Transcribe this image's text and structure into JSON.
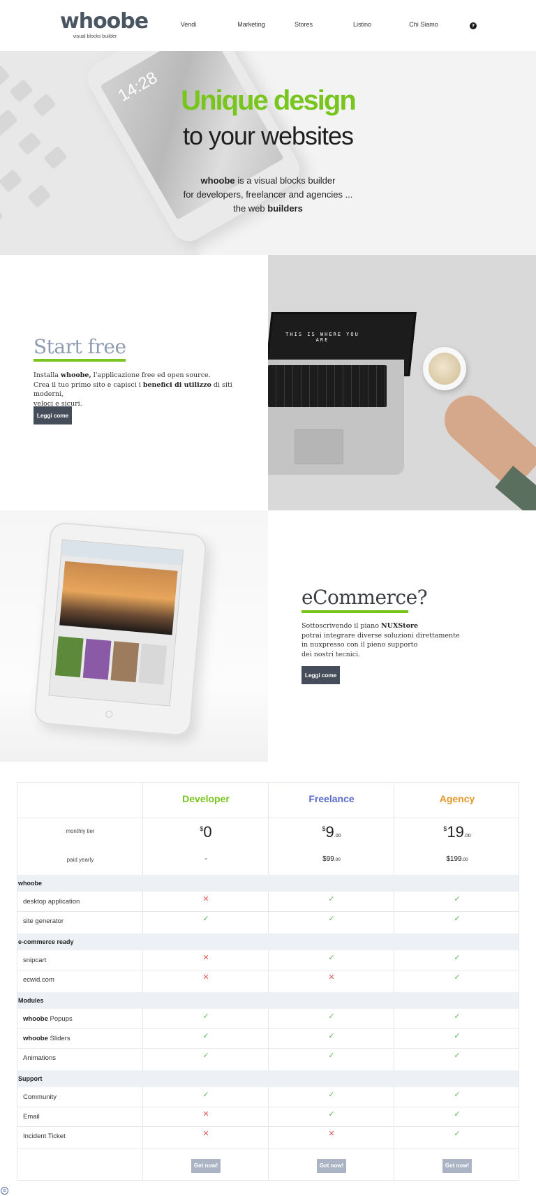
{
  "header": {
    "logo": "whoobe",
    "logo_sub": "visual blocks builder",
    "nav": [
      "Vendi",
      "Marketing",
      "Stores",
      "Listino",
      "Chi Siamo"
    ],
    "help_icon": "?"
  },
  "hero": {
    "title_green": "Unique design",
    "title_dark": "to your websites",
    "line1_bold": "whoobe",
    "line1_rest": " is a visual blocks builder",
    "line2": "for developers, freelancer and agencies ...",
    "line3_pre": "the web ",
    "line3_bold": "builders",
    "phone_time": "14:28"
  },
  "start_free": {
    "title": "Start free",
    "p1_pre": "Installa ",
    "p1_bold": "whoobe,",
    "p1_post": " l'applicazione free ed open source.",
    "p2_pre": "Crea il tuo primo sito e capisci i ",
    "p2_bold": "benefici di utilizzo",
    "p2_post": " di siti moderni,",
    "p3": "veloci e sicuri.",
    "button": "Leggi come",
    "laptop_text": "THIS IS WHERE YOU ARE"
  },
  "ecommerce": {
    "title": "eCommerce?",
    "p1_pre": "Sottoscrivendo il piano ",
    "p1_bold": "NUXStore",
    "p2": "potrai integrare diverse soluzioni direttamente",
    "p3": "in nuxpresso con il pieno supporto",
    "p4": "dei nostri tecnici.",
    "button": "Leggi come"
  },
  "pricing": {
    "plans": [
      {
        "name": "Developer",
        "color": "#78c51e",
        "monthly_cur": "$",
        "monthly": "0",
        "monthly_dec": "",
        "yearly": "-",
        "yearly_dec": "",
        "yearly_cur": ""
      },
      {
        "name": "Freelance",
        "color": "#5a6ac8",
        "monthly_cur": "$",
        "monthly": "9",
        "monthly_dec": ".00",
        "yearly_cur": "$",
        "yearly": "99",
        "yearly_dec": ".00"
      },
      {
        "name": "Agency",
        "color": "#e0992a",
        "monthly_cur": "$",
        "monthly": "19",
        "monthly_dec": ".00",
        "yearly_cur": "$",
        "yearly": "199",
        "yearly_dec": ".00"
      }
    ],
    "monthly_label": "monthly tier",
    "yearly_label": "paid yearly",
    "groups": [
      {
        "label": "whoobe",
        "rows": [
          {
            "label": "desktop application",
            "values": [
              false,
              true,
              true
            ]
          },
          {
            "label": "site generator",
            "values": [
              true,
              true,
              true
            ]
          }
        ]
      },
      {
        "label": "e-commerce ready",
        "rows": [
          {
            "label": "snipcart",
            "values": [
              false,
              true,
              true
            ]
          },
          {
            "label": "ecwid.com",
            "values": [
              false,
              false,
              true
            ]
          }
        ]
      },
      {
        "label": "Modules",
        "rows": [
          {
            "label_bold": "whoobe",
            "label": " Popups",
            "values": [
              true,
              true,
              true
            ]
          },
          {
            "label_bold": "whoobe",
            "label": " Sliders",
            "values": [
              true,
              true,
              true
            ]
          },
          {
            "label": "Animations",
            "values": [
              true,
              true,
              true
            ]
          }
        ]
      },
      {
        "label": "Support",
        "rows": [
          {
            "label": "Community",
            "values": [
              true,
              true,
              true
            ]
          },
          {
            "label": "Email",
            "values": [
              false,
              true,
              true
            ]
          },
          {
            "label": "Incident Ticket",
            "values": [
              false,
              false,
              true
            ]
          }
        ]
      }
    ],
    "button": "Get now!",
    "check": "✓",
    "cross": "✕"
  },
  "colors": {
    "accent": "#78c51e",
    "dark_button": "#454d5b",
    "get_button": "#aab4c4",
    "title_blue_grey": "#8e9bb1",
    "title_dark": "#3b3f45"
  }
}
